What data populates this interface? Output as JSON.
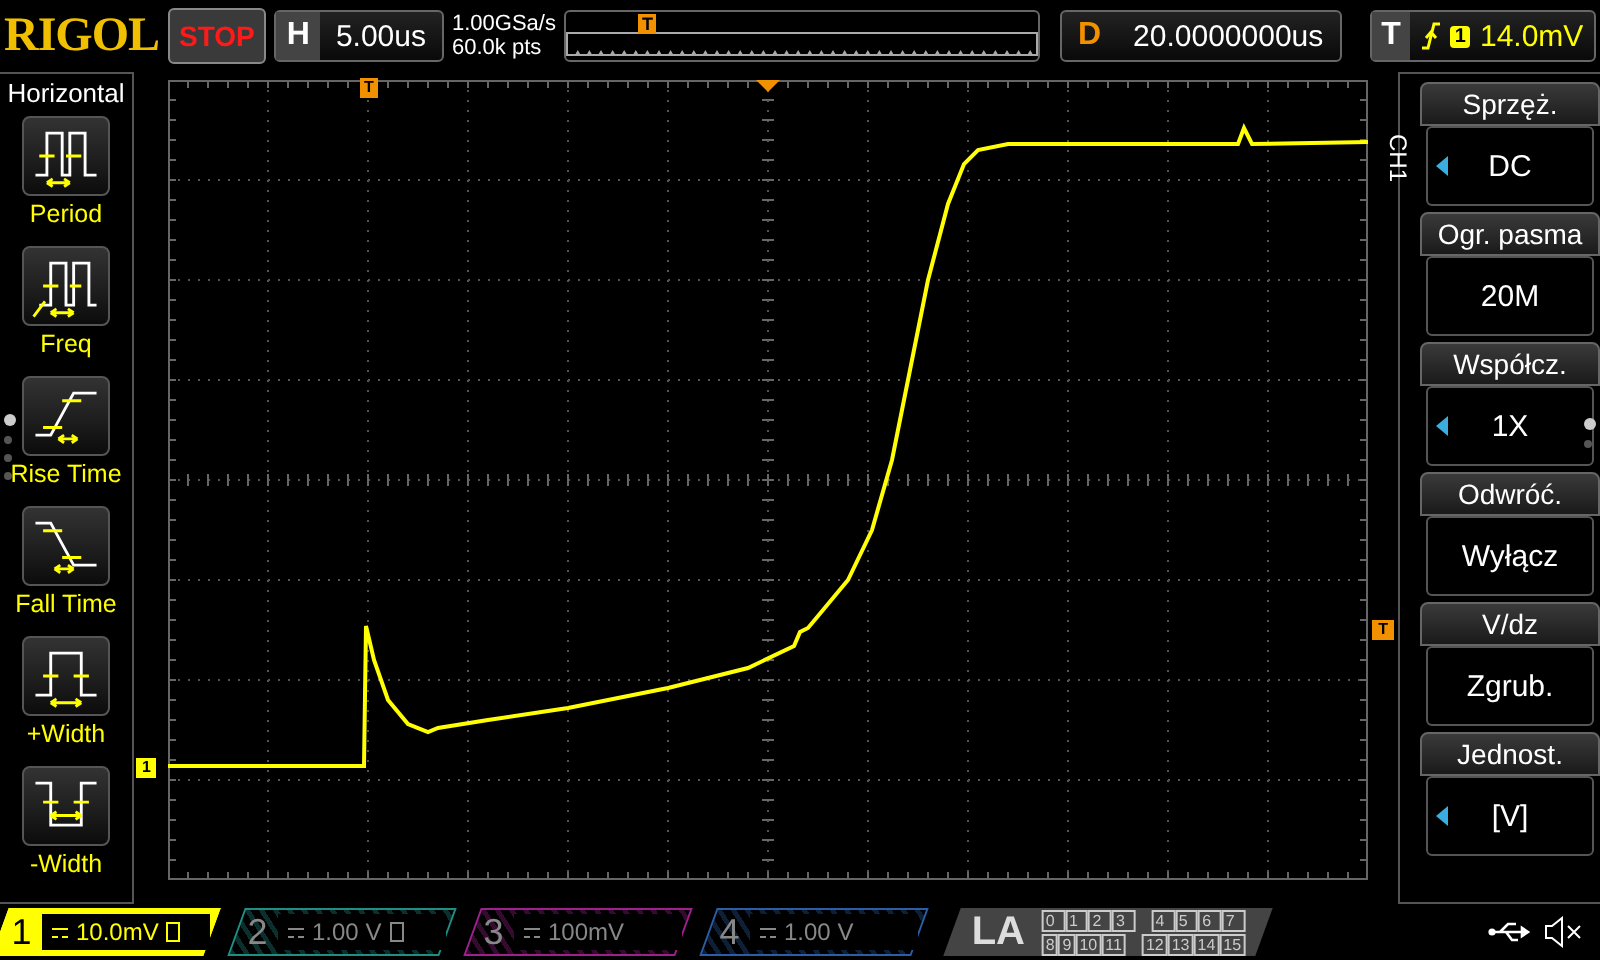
{
  "top_bar": {
    "logo": "RIGOL",
    "run_state": "STOP",
    "timebase_label": "H",
    "timebase": "5.00us",
    "sample_rate": "1.00GSa/s",
    "memory_depth": "60.0k pts",
    "memory_marker": "T",
    "delay_label": "D",
    "delay": "20.0000000us",
    "trigger_label": "T",
    "trigger_source": "1",
    "trigger_level": "14.0mV"
  },
  "left_menu": {
    "title": "Horizontal",
    "items": [
      {
        "kind": "period",
        "label": "Period"
      },
      {
        "kind": "freq",
        "label": "Freq"
      },
      {
        "kind": "rise",
        "label": "Rise Time"
      },
      {
        "kind": "fall",
        "label": "Fall Time"
      },
      {
        "kind": "pos_width",
        "label": "+Width"
      },
      {
        "kind": "neg_width",
        "label": "-Width"
      }
    ],
    "page_dots": [
      {
        "selected": true
      },
      {
        "selected": false
      },
      {
        "selected": false
      },
      {
        "selected": false
      }
    ]
  },
  "plot": {
    "channel_marker": "1",
    "trigger_level_marker": "T",
    "trigger_position_marker": "T"
  },
  "right_menu": {
    "channel": "CH1",
    "items": [
      {
        "title": "Sprzęż.",
        "value": "DC",
        "has_arrow": true
      },
      {
        "title": "Ogr. pasma",
        "value": "20M",
        "has_arrow": false
      },
      {
        "title": "Współcz.",
        "value": "1X",
        "has_arrow": true
      },
      {
        "title": "Odwróć.",
        "value": "Wyłącz",
        "has_arrow": false
      },
      {
        "title": "V/dz",
        "value": "Zgrub.",
        "has_arrow": false
      },
      {
        "title": "Jednost.",
        "value": "[V]",
        "has_arrow": true
      }
    ],
    "page_dots": [
      {
        "selected": true
      },
      {
        "selected": false
      }
    ]
  },
  "channels": [
    {
      "number": "1",
      "scale": "10.0mV",
      "on": true,
      "bw_limit": true,
      "color": "#ffff00"
    },
    {
      "number": "2",
      "scale": "1.00 V",
      "on": false,
      "bw_limit": true,
      "color": "#1f8f86"
    },
    {
      "number": "3",
      "scale": "100mV",
      "on": false,
      "bw_limit": false,
      "color": "#a0208f"
    },
    {
      "number": "4",
      "scale": "1.00 V",
      "on": false,
      "bw_limit": false,
      "color": "#2a5fa8"
    }
  ],
  "logic_analyzer": {
    "label": "LA",
    "rows": [
      [
        "0",
        "1",
        "2",
        "3",
        "4",
        "5",
        "6",
        "7"
      ],
      [
        "8",
        "9",
        "10",
        "11",
        "12",
        "13",
        "14",
        "15"
      ]
    ]
  }
}
